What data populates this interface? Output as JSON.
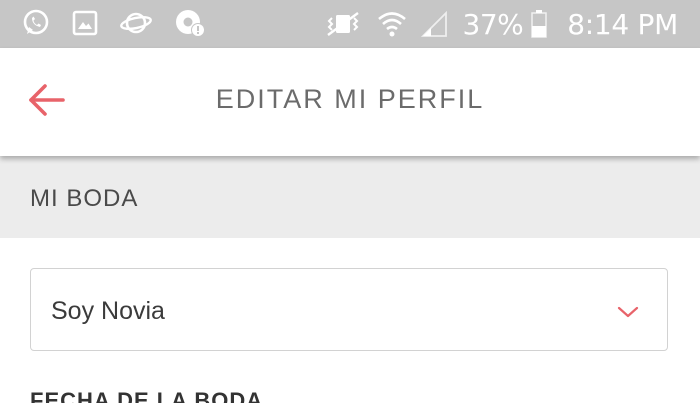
{
  "status_bar": {
    "battery_percent": "37%",
    "time": "8:14 PM",
    "left_icons": [
      "whatsapp-icon",
      "gallery-icon",
      "planet-icon",
      "chrome-alert-icon"
    ],
    "right_icons": [
      "vibrate-icon",
      "wifi-icon",
      "signal-icon",
      "battery-icon"
    ]
  },
  "app_bar": {
    "title": "EDITAR MI PERFIL",
    "back_icon": "arrow-left-icon",
    "accent_color": "#e8636a"
  },
  "section": {
    "title": "MI BODA"
  },
  "form": {
    "role_select": {
      "selected": "Soy Novia",
      "icon": "chevron-down-icon"
    },
    "next_field_label": "FECHA DE LA BODA"
  },
  "colors": {
    "status_bar_bg": "#c6c6c6",
    "section_bg": "#ececec",
    "accent": "#e8636a",
    "title_text": "#6b6b6b"
  }
}
